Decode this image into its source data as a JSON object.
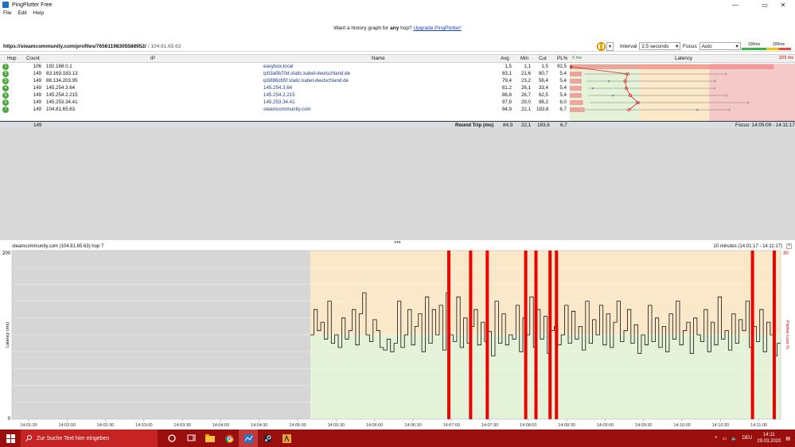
{
  "window": {
    "title": "PingPlotter Free"
  },
  "menu": [
    "File",
    "Edit",
    "Help"
  ],
  "banner": {
    "prefix": "Want a history graph for",
    "emphasis": "any",
    "middle": "hop?",
    "link": "Upgrade PingPlotter!"
  },
  "target": {
    "url": "https://steamcommunity.com/profiles/76561198305588952/",
    "ip": "/ 104.81.65.63"
  },
  "controls": {
    "interval_label": "Interval",
    "interval_value": "2,5 seconds",
    "focus_label": "Focus",
    "focus_value": "Auto",
    "scale_100": "100ms",
    "scale_200": "200ms"
  },
  "table": {
    "headers": {
      "hop": "Hop",
      "count": "Count",
      "ip": "IP",
      "name": "Name",
      "avg": "Avg",
      "min": "Min",
      "cur": "Cur",
      "pl": "PL%",
      "zero_ms": "0 ms",
      "latency": "Latency",
      "max_ms": "323 ms"
    },
    "rows": [
      {
        "hop": "1",
        "count": "106",
        "ip": "192.168.0.1",
        "name": "easybox.local",
        "avg": "1,5",
        "min": "1,1",
        "cur": "1,5",
        "pl": "92,5"
      },
      {
        "hop": "2",
        "count": "149",
        "ip": "83.169.183.13",
        "name": "ip53a9b70d.static.kabel-deutschland.de",
        "avg": "83,1",
        "min": "21,6",
        "cur": "80,7",
        "pl": "5,4"
      },
      {
        "hop": "3",
        "count": "149",
        "ip": "88.134.203.95",
        "name": "ip5886cb5f.static.kabel-deutschland.de",
        "avg": "79,4",
        "min": "23,2",
        "cur": "56,4",
        "pl": "5,4"
      },
      {
        "hop": "4",
        "count": "149",
        "ip": "145.254.3.64",
        "name": "145.254.3.64",
        "avg": "81,2",
        "min": "26,1",
        "cur": "33,4",
        "pl": "5,4"
      },
      {
        "hop": "5",
        "count": "149",
        "ip": "145.254.2.215",
        "name": "145.254.2.215",
        "avg": "86,8",
        "min": "26,7",
        "cur": "62,5",
        "pl": "5,4"
      },
      {
        "hop": "6",
        "count": "149",
        "ip": "145.253.34.41",
        "name": "145.253.34.41",
        "avg": "97,8",
        "min": "29,0",
        "cur": "98,2",
        "pl": "6,0"
      },
      {
        "hop": "7",
        "count": "149",
        "ip": "104.81.65.63",
        "name": "steamcommunity.com",
        "avg": "84,9",
        "min": "22,1",
        "cur": "183,6",
        "pl": "6,7"
      }
    ],
    "summary": {
      "count": "149",
      "label": "Round Trip (ms)",
      "avg": "84,9",
      "min": "22,1",
      "cur": "183,6",
      "pl": "6,7",
      "focus": "Focus: 14:05:09 - 14:11:17"
    }
  },
  "graph": {
    "title": "steamcommunity.com (104.81.65.63) hop 7",
    "range": "10 minutes (14:01:17 - 14:11:17)",
    "ylabel": "Latency (ms)",
    "y2label": "Packet Loss %",
    "y_top": "200",
    "y_bottom": "0",
    "y2_top": "30",
    "x_ticks": [
      "14:01:30",
      "14:02:00",
      "14:02:30",
      "14:03:00",
      "14:03:30",
      "14:04:00",
      "14:04:30",
      "14:05:00",
      "14:05:30",
      "14:06:00",
      "14:06:30",
      "14:07:00",
      "14:07:30",
      "14:08:00",
      "14:08:30",
      "14:09:00",
      "14:09:30",
      "14:10:00",
      "14:10:30",
      "14:11:00"
    ]
  },
  "chart_data": {
    "type": "line",
    "ylim": [
      0,
      200
    ],
    "x_range": [
      "14:01:17",
      "14:11:17"
    ],
    "series": [
      {
        "values": [
          100,
          130,
          105,
          115,
          95,
          140,
          90,
          100,
          85,
          120,
          95,
          105,
          130,
          88,
          125,
          150,
          100,
          92,
          118,
          105,
          85,
          82,
          95,
          80,
          90,
          140,
          85,
          100,
          130,
          88,
          110,
          125,
          80,
          145,
          90,
          130,
          100,
          135,
          82,
          150,
          100,
          92,
          145,
          85,
          120,
          90,
          110,
          130,
          88,
          115,
          92,
          104,
          75,
          140,
          90,
          125,
          88,
          100,
          95,
          135,
          80,
          120,
          100,
          145,
          85,
          130,
          95,
          122,
          78,
          105,
          110,
          88,
          100,
          135,
          90,
          128,
          95,
          110,
          82,
          140,
          90,
          118,
          100,
          135,
          88,
          125,
          85,
          115,
          140,
          92,
          105,
          130,
          90,
          112,
          78,
          100,
          88,
          135,
          92,
          120,
          85,
          110,
          80,
          125,
          95,
          140,
          88,
          105,
          115,
          78,
          120,
          100,
          92,
          130,
          80,
          115,
          88,
          145,
          95,
          105,
          82,
          125,
          90,
          118,
          105,
          140,
          85,
          110,
          92,
          130,
          80,
          115,
          100,
          75,
          90
        ]
      }
    ],
    "loss_times": [
      "14:06:58",
      "14:07:15",
      "14:07:28",
      "14:07:58",
      "14:08:06",
      "14:08:17",
      "14:08:22",
      "14:10:55",
      "14:11:12"
    ]
  },
  "taskbar": {
    "search_placeholder": "Zur Suche Text hier eingeben",
    "lang": "DEU",
    "time": "14:11",
    "date": "29.03.2020"
  }
}
